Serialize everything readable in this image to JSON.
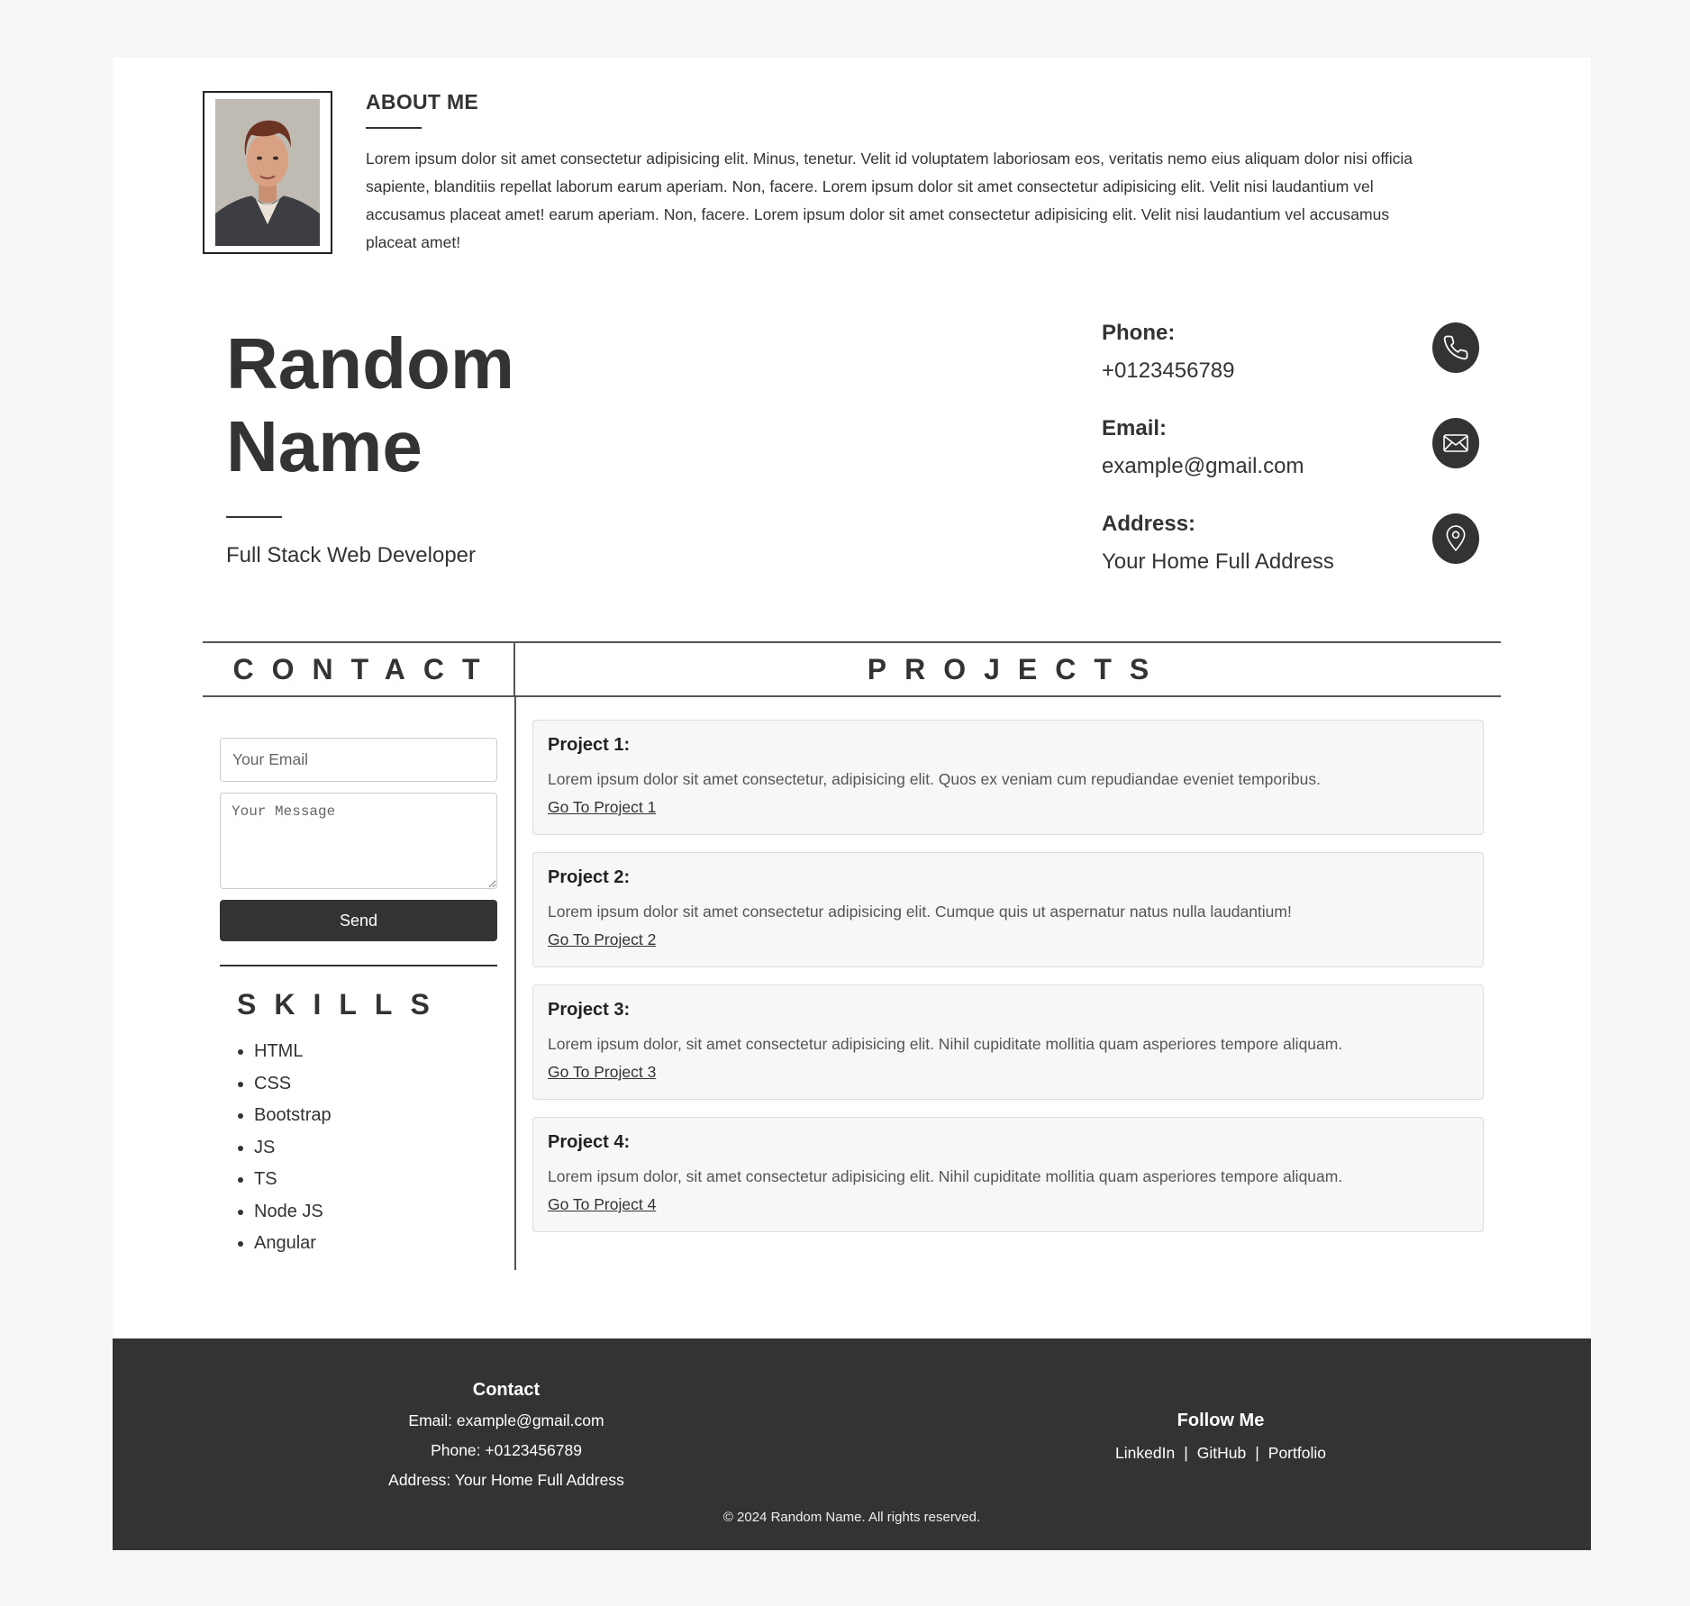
{
  "about": {
    "title": "ABOUT ME",
    "text": "Lorem ipsum dolor sit amet consectetur adipisicing elit. Minus, tenetur. Velit id voluptatem laboriosam eos, veritatis nemo eius aliquam dolor nisi officia sapiente, blanditiis repellat laborum earum aperiam. Non, facere. Lorem ipsum dolor sit amet consectetur adipisicing elit. Velit nisi laudantium vel accusamus placeat amet! earum aperiam. Non, facere. Lorem ipsum dolor sit amet consectetur adipisicing elit. Velit nisi laudantium vel accusamus placeat amet!"
  },
  "profile": {
    "name": "Random Name",
    "job_title": "Full Stack Web Developer"
  },
  "info": {
    "phone_label": "Phone:",
    "phone_value": "+0123456789",
    "email_label": "Email:",
    "email_value": "example@gmail.com",
    "address_label": "Address:",
    "address_value": "Your Home Full Address"
  },
  "sections": {
    "contact_heading": "CONTACT",
    "projects_heading": "PROJECTS",
    "skills_heading": "SKILLS"
  },
  "form": {
    "email_placeholder": "Your Email",
    "message_placeholder": "Your Message",
    "send_label": "Send"
  },
  "skills": [
    "HTML",
    "CSS",
    "Bootstrap",
    "JS",
    "TS",
    "Node JS",
    "Angular"
  ],
  "projects": [
    {
      "title": "Project 1:",
      "desc": "Lorem ipsum dolor sit amet consectetur, adipisicing elit. Quos ex veniam cum repudiandae eveniet temporibus.",
      "link": "Go To Project 1"
    },
    {
      "title": "Project 2:",
      "desc": "Lorem ipsum dolor sit amet consectetur adipisicing elit. Cumque quis ut aspernatur natus nulla laudantium!",
      "link": "Go To Project 2"
    },
    {
      "title": "Project 3:",
      "desc": "Lorem ipsum dolor, sit amet consectetur adipisicing elit. Nihil cupiditate mollitia quam asperiores tempore aliquam.",
      "link": "Go To Project 3"
    },
    {
      "title": "Project 4:",
      "desc": "Lorem ipsum dolor, sit amet consectetur adipisicing elit. Nihil cupiditate mollitia quam asperiores tempore aliquam.",
      "link": "Go To Project 4"
    }
  ],
  "footer": {
    "contact_heading": "Contact",
    "email_line": "Email: example@gmail.com",
    "phone_line": "Phone: +0123456789",
    "address_line": "Address: Your Home Full Address",
    "follow_heading": "Follow Me",
    "links": [
      "LinkedIn",
      "GitHub",
      "Portfolio"
    ],
    "separator": "|",
    "copyright": "© 2024 Random Name. All rights reserved."
  },
  "icons": {
    "phone": "phone-icon",
    "email": "envelope-icon",
    "address": "map-pin-icon"
  },
  "colors": {
    "dark": "#333333",
    "page_bg": "#f6f6f6",
    "card_bg": "#f7f7f7"
  }
}
